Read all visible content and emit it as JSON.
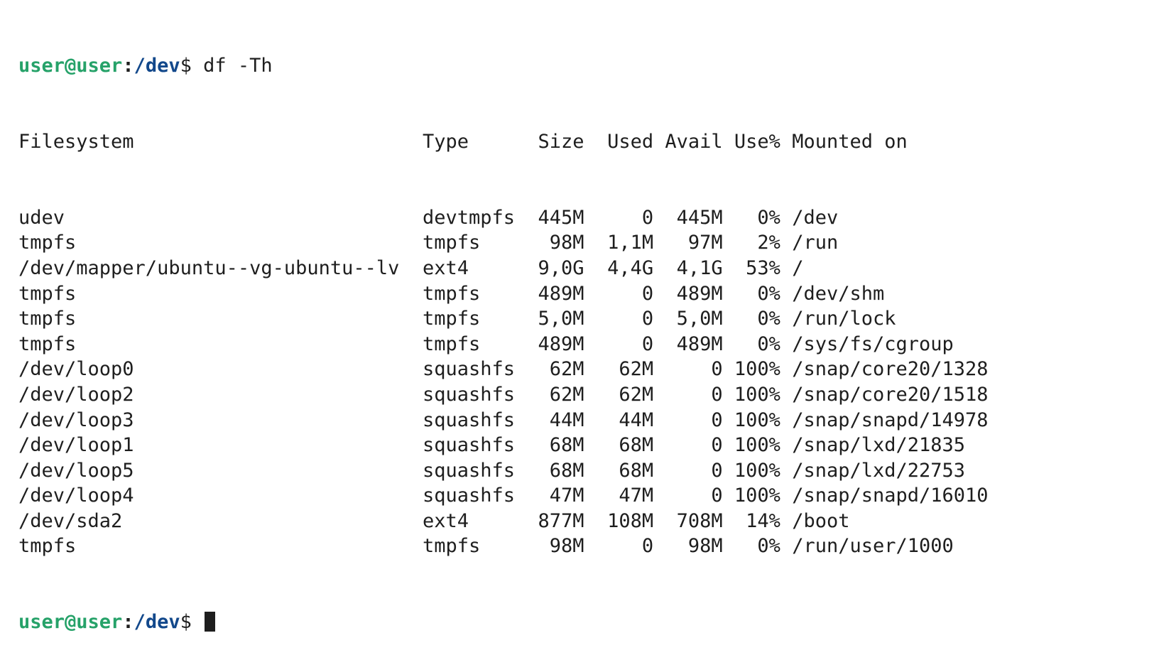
{
  "terminal": {
    "prompt": {
      "user_host": "user@user",
      "colon": ":",
      "path": "/dev",
      "dollar": "$"
    },
    "command": "df -Th",
    "header": {
      "filesystem": "Filesystem",
      "type": "Type",
      "size": "Size",
      "used": "Used",
      "avail": "Avail",
      "use_pct": "Use%",
      "mounted_on": "Mounted on"
    },
    "rows": [
      {
        "filesystem": "udev",
        "type": "devtmpfs",
        "size": "445M",
        "used": "0",
        "avail": "445M",
        "use_pct": "0%",
        "mounted_on": "/dev"
      },
      {
        "filesystem": "tmpfs",
        "type": "tmpfs",
        "size": "98M",
        "used": "1,1M",
        "avail": "97M",
        "use_pct": "2%",
        "mounted_on": "/run"
      },
      {
        "filesystem": "/dev/mapper/ubuntu--vg-ubuntu--lv",
        "type": "ext4",
        "size": "9,0G",
        "used": "4,4G",
        "avail": "4,1G",
        "use_pct": "53%",
        "mounted_on": "/"
      },
      {
        "filesystem": "tmpfs",
        "type": "tmpfs",
        "size": "489M",
        "used": "0",
        "avail": "489M",
        "use_pct": "0%",
        "mounted_on": "/dev/shm"
      },
      {
        "filesystem": "tmpfs",
        "type": "tmpfs",
        "size": "5,0M",
        "used": "0",
        "avail": "5,0M",
        "use_pct": "0%",
        "mounted_on": "/run/lock"
      },
      {
        "filesystem": "tmpfs",
        "type": "tmpfs",
        "size": "489M",
        "used": "0",
        "avail": "489M",
        "use_pct": "0%",
        "mounted_on": "/sys/fs/cgroup"
      },
      {
        "filesystem": "/dev/loop0",
        "type": "squashfs",
        "size": "62M",
        "used": "62M",
        "avail": "0",
        "use_pct": "100%",
        "mounted_on": "/snap/core20/1328"
      },
      {
        "filesystem": "/dev/loop2",
        "type": "squashfs",
        "size": "62M",
        "used": "62M",
        "avail": "0",
        "use_pct": "100%",
        "mounted_on": "/snap/core20/1518"
      },
      {
        "filesystem": "/dev/loop3",
        "type": "squashfs",
        "size": "44M",
        "used": "44M",
        "avail": "0",
        "use_pct": "100%",
        "mounted_on": "/snap/snapd/14978"
      },
      {
        "filesystem": "/dev/loop1",
        "type": "squashfs",
        "size": "68M",
        "used": "68M",
        "avail": "0",
        "use_pct": "100%",
        "mounted_on": "/snap/lxd/21835"
      },
      {
        "filesystem": "/dev/loop5",
        "type": "squashfs",
        "size": "68M",
        "used": "68M",
        "avail": "0",
        "use_pct": "100%",
        "mounted_on": "/snap/lxd/22753"
      },
      {
        "filesystem": "/dev/loop4",
        "type": "squashfs",
        "size": "47M",
        "used": "47M",
        "avail": "0",
        "use_pct": "100%",
        "mounted_on": "/snap/snapd/16010"
      },
      {
        "filesystem": "/dev/sda2",
        "type": "ext4",
        "size": "877M",
        "used": "108M",
        "avail": "708M",
        "use_pct": "14%",
        "mounted_on": "/boot"
      },
      {
        "filesystem": "tmpfs",
        "type": "tmpfs",
        "size": "98M",
        "used": "0",
        "avail": "98M",
        "use_pct": "0%",
        "mounted_on": "/run/user/1000"
      }
    ],
    "colors": {
      "background": "#ffffff",
      "text": "#1e1e1e",
      "prompt_user": "#26a269",
      "prompt_path": "#12488b"
    }
  }
}
